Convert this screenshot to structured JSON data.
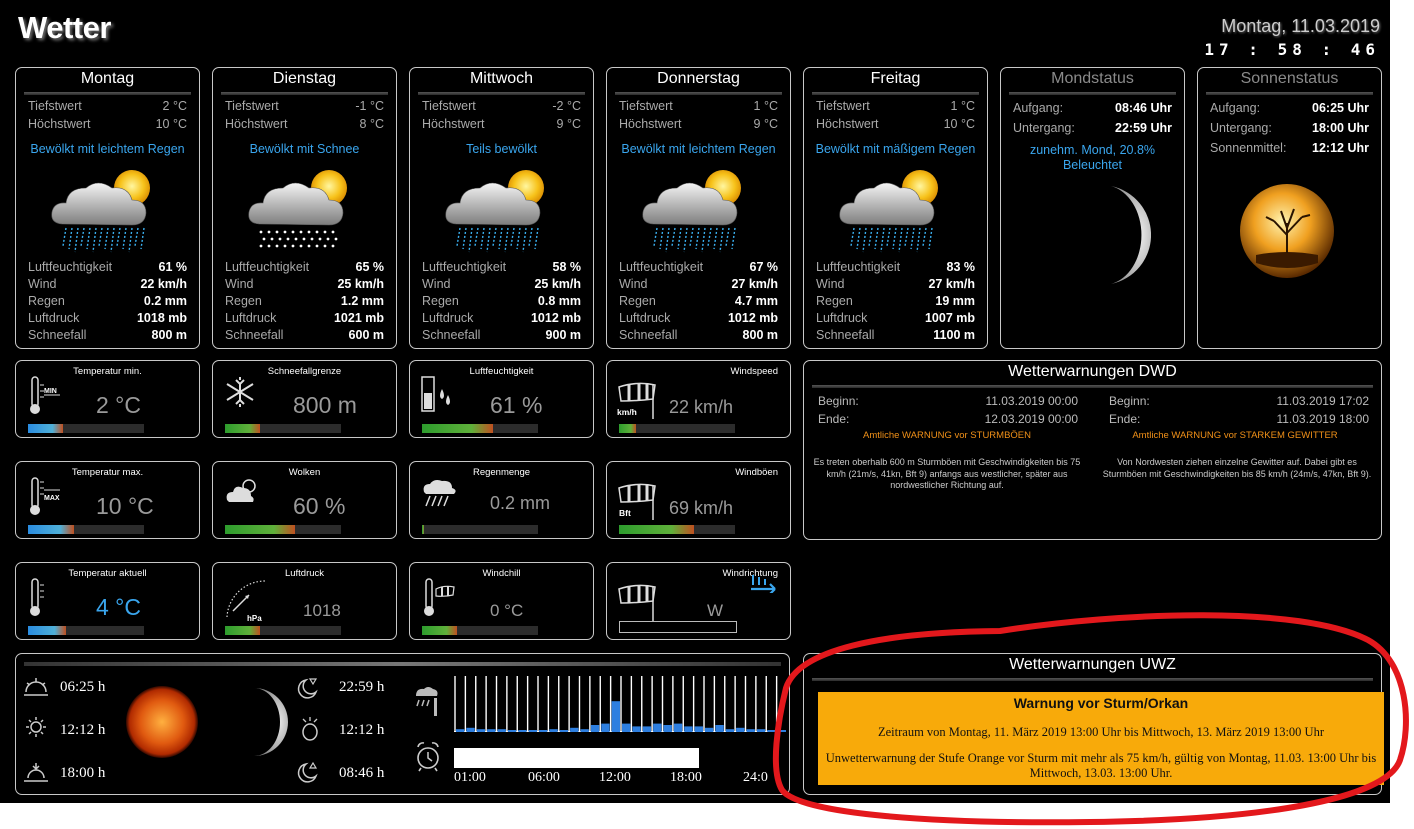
{
  "app": {
    "title": "Wetter",
    "date": "Montag, 11.03.2019",
    "time": "17 : 58 : 46"
  },
  "labels": {
    "tiefstwert": "Tiefstwert",
    "hoechstwert": "Höchstwert",
    "luftfeuchtigkeit": "Luftfeuchtigkeit",
    "wind": "Wind",
    "regen": "Regen",
    "luftdruck": "Luftdruck",
    "schneefall": "Schneefall"
  },
  "forecast": [
    {
      "day": "Montag",
      "min": "2 °C",
      "max": "10 °C",
      "condition": "Bewölkt mit leichtem Regen",
      "icon": "cloud-sun-rain-icon",
      "humidity": "61 %",
      "wind": "22 km/h",
      "rain": "0.2 mm",
      "pressure": "1018 mb",
      "snowline": "800 m"
    },
    {
      "day": "Dienstag",
      "min": "-1 °C",
      "max": "8 °C",
      "condition": "Bewölkt mit Schnee",
      "icon": "cloud-sun-snow-icon",
      "humidity": "65 %",
      "wind": "25 km/h",
      "rain": "1.2 mm",
      "pressure": "1021 mb",
      "snowline": "600 m"
    },
    {
      "day": "Mittwoch",
      "min": "-2 °C",
      "max": "9 °C",
      "condition": "Teils bewölkt",
      "icon": "cloud-sun-rain-icon",
      "humidity": "58 %",
      "wind": "25 km/h",
      "rain": "0.8 mm",
      "pressure": "1012 mb",
      "snowline": "900 m"
    },
    {
      "day": "Donnerstag",
      "min": "1 °C",
      "max": "9 °C",
      "condition": "Bewölkt mit leichtem Regen",
      "icon": "cloud-sun-rain-icon",
      "humidity": "67 %",
      "wind": "27 km/h",
      "rain": "4.7 mm",
      "pressure": "1012 mb",
      "snowline": "800 m"
    },
    {
      "day": "Freitag",
      "min": "1 °C",
      "max": "10 °C",
      "condition": "Bewölkt mit mäßigem Regen",
      "icon": "cloud-sun-rain-icon",
      "humidity": "83 %",
      "wind": "27 km/h",
      "rain": "19 mm",
      "pressure": "1007 mb",
      "snowline": "1100 m"
    }
  ],
  "moon": {
    "title": "Mondstatus",
    "rise_label": "Aufgang:",
    "rise": "08:46 Uhr",
    "set_label": "Untergang:",
    "set": "22:59 Uhr",
    "phase": "zunehm. Mond, 20.8%",
    "illum": "Beleuchtet"
  },
  "sun": {
    "title": "Sonnenstatus",
    "rise_label": "Aufgang:",
    "rise": "06:25 Uhr",
    "set_label": "Untergang:",
    "set": "18:00 Uhr",
    "noon_label": "Sonnenmittel:",
    "noon": "12:12 Uhr"
  },
  "tiles": [
    {
      "title": "Temperatur min.",
      "value": "2 °C",
      "icon": "thermometer-min-icon",
      "level": 0.3
    },
    {
      "title": "Schneefallgrenze",
      "value": "800 m",
      "icon": "snowflake-icon",
      "level": 0.3
    },
    {
      "title": "Luftfeuchtigkeit",
      "value": "61 %",
      "icon": "humidity-icon",
      "level": 0.61
    },
    {
      "title": "Windspeed",
      "value": "22 km/h",
      "icon": "windsock-kmh-icon",
      "level": 0.15
    },
    {
      "title": "Temperatur max.",
      "value": "10 °C",
      "icon": "thermometer-max-icon",
      "level": 0.4
    },
    {
      "title": "Wolken",
      "value": "60 %",
      "icon": "clouds-icon",
      "level": 0.6
    },
    {
      "title": "Regenmenge",
      "value": "0.2 mm",
      "icon": "rain-cloud-icon",
      "level": 0.02
    },
    {
      "title": "Windböen",
      "value": "69 km/h",
      "icon": "windsock-bft-icon",
      "level": 0.65
    },
    {
      "title": "Temperatur aktuell",
      "value": "4 °C",
      "icon": "thermometer-icon",
      "level": 0.33
    },
    {
      "title": "Luftdruck",
      "value": "1018",
      "icon": "barometer-icon",
      "level": 0.3
    },
    {
      "title": "Windchill",
      "value": "0 °C",
      "icon": "windchill-icon",
      "level": 0.3
    },
    {
      "title": "Windrichtung",
      "value": "W",
      "icon": "windsock-icon",
      "level": 0
    }
  ],
  "tile_units": {
    "kmh": "km/h",
    "bft": "Bft",
    "hpa": "hPa",
    "min": "MIN",
    "max": "MAX"
  },
  "dwd": {
    "title": "Wetterwarnungen DWD",
    "begin_label": "Beginn:",
    "end_label": "Ende:",
    "warnings": [
      {
        "begin": "11.03.2019 00:00",
        "end": "12.03.2019 00:00",
        "headline": "Amtliche WARNUNG vor STURMBÖEN",
        "text": "Es treten oberhalb 600 m Sturmböen mit Geschwindigkeiten bis 75 km/h (21m/s, 41kn, Bft 9) anfangs aus westlicher, später aus nordwestlicher Richtung auf."
      },
      {
        "begin": "11.03.2019 17:02",
        "end": "11.03.2019 18:00",
        "headline": "Amtliche WARNUNG vor STARKEM GEWITTER",
        "text": "Von Nordwesten ziehen einzelne Gewitter auf. Dabei gibt es Sturmböen mit Geschwindigkeiten bis 85 km/h (24m/s, 47kn, Bft 9)."
      }
    ]
  },
  "uwz": {
    "title": "Wetterwarnungen UWZ",
    "headline": "Warnung vor Sturm/Orkan",
    "period": "Zeitraum von Montag, 11. März 2019 13:00 Uhr bis Mittwoch, 13. März 2019 13:00 Uhr",
    "text": "Unwetterwarnung der Stufe Orange vor Sturm mit mehr als 75 km/h, gültig von Montag, 11.03. 13:00 Uhr bis Mittwoch, 13.03. 13:00 Uhr.",
    "color": "#f8aa0a"
  },
  "daylight": {
    "sunrise": "06:25 h",
    "noon": "12:12 h",
    "sunset": "18:00 h",
    "moonset": "22:59 h",
    "moonnoon": "12:12 h",
    "moonrise": "08:46 h"
  },
  "rain_chart": {
    "x_labels": [
      "01:00",
      "06:00",
      "12:00",
      "18:00",
      "24:0"
    ],
    "values": [
      0.1,
      0.15,
      0.1,
      0.1,
      0.1,
      0.05,
      0.05,
      0.05,
      0.05,
      0.1,
      0.05,
      0.15,
      0.1,
      0.25,
      0.3,
      1.1,
      0.3,
      0.2,
      0.2,
      0.3,
      0.25,
      0.3,
      0.2,
      0.2,
      0.15,
      0.25,
      0.1,
      0.15,
      0.1,
      0.1,
      0.05,
      0.05
    ],
    "color": "#2e7fe0"
  },
  "accent_colors": {
    "condition": "#3aa6ee",
    "warning_headline": "#f09018",
    "annotation": "#e3181c"
  }
}
